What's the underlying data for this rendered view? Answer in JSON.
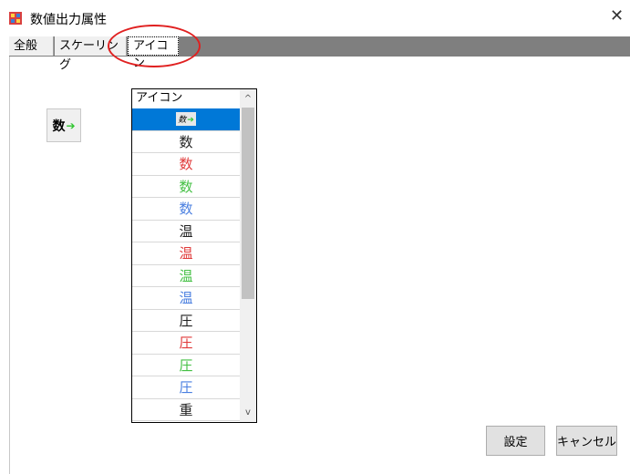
{
  "window": {
    "title": "数値出力属性",
    "close_glyph": "✕"
  },
  "tabs": [
    {
      "label": "全般"
    },
    {
      "label": "スケーリング"
    },
    {
      "label": "アイコン"
    }
  ],
  "preview": {
    "char": "数",
    "arrow": "➔"
  },
  "list": {
    "header": "アイコン",
    "selected_index": 0,
    "selected_item": {
      "char": "数",
      "arrow": "➔"
    },
    "items": [
      {
        "char": "数",
        "color": "#222222"
      },
      {
        "char": "数",
        "color": "#e03a3a"
      },
      {
        "char": "数",
        "color": "#44c044"
      },
      {
        "char": "数",
        "color": "#4a7fe0"
      },
      {
        "char": "温",
        "color": "#222222"
      },
      {
        "char": "温",
        "color": "#e03a3a"
      },
      {
        "char": "温",
        "color": "#44c044"
      },
      {
        "char": "温",
        "color": "#4a7fe0"
      },
      {
        "char": "圧",
        "color": "#222222"
      },
      {
        "char": "圧",
        "color": "#e03a3a"
      },
      {
        "char": "圧",
        "color": "#44c044"
      },
      {
        "char": "圧",
        "color": "#4a7fe0"
      },
      {
        "char": "重",
        "color": "#222222"
      }
    ],
    "scroll_up_glyph": "^",
    "scroll_down_glyph": "v"
  },
  "buttons": {
    "set": "設定",
    "cancel": "キャンセル"
  },
  "colors": {
    "selection": "#0078d7",
    "arrow": "#2fc62f",
    "callout": "#e02020"
  }
}
